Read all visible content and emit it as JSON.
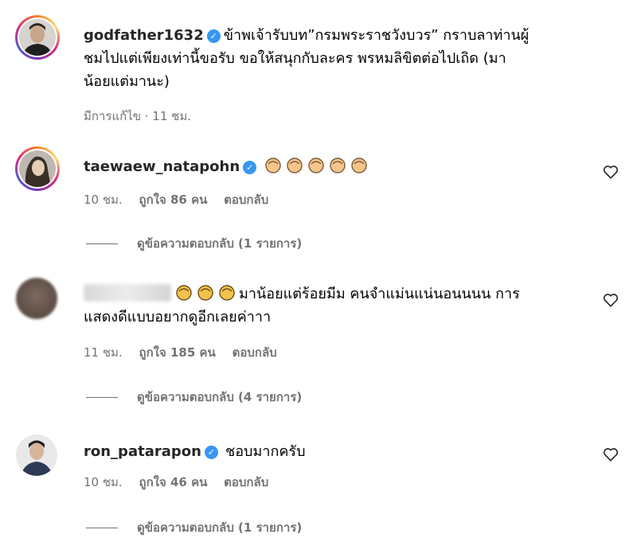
{
  "comments": [
    {
      "username": "godfather1632",
      "line1": "ข้าพเจ้ารับบท”กรมพระราชวังบวร” กราบลาท่านผู้",
      "line2": "ชมไปแต่เพียงเท่านี้ขอรับ ขอให้สนุกกับละคร พรหมลิขิตต่อไปเถิด (มา",
      "line3": "น้อยแต่มานะ)",
      "edited": "มีการแก้ไข · 11 ชม."
    },
    {
      "username": "taewaew_natapohn",
      "time": "10 ชม.",
      "likes": "ถูกใจ 86 คน",
      "reply": "ตอบกลับ",
      "view_replies": "ดูข้อความตอบกลับ (1 รายการ)"
    },
    {
      "line1": "มาน้อยแต่ร้อยมีม คนจำแม่นแน่นอนนนน การ",
      "line2": "แสดงดีแบบอยากดูอีกเลยค่าาา",
      "time": "11 ชม.",
      "likes": "ถูกใจ 185 คน",
      "reply": "ตอบกลับ",
      "view_replies": "ดูข้อความตอบกลับ (4 รายการ)"
    },
    {
      "username": "ron_patarapon",
      "text": "ชอบมากครับ",
      "time": "10 ชม.",
      "likes": "ถูกใจ 46 คน",
      "reply": "ตอบกลับ",
      "view_replies": "ดูข้อความตอบกลับ (1 รายการ)"
    }
  ],
  "icons": {
    "verified": "verified-badge-icon",
    "like": "heart-outline-icon",
    "clap": "clapping-hands-emoji"
  },
  "colors": {
    "verified": "#3797f0",
    "meta": "#737373",
    "clap": "#f5c58a"
  }
}
